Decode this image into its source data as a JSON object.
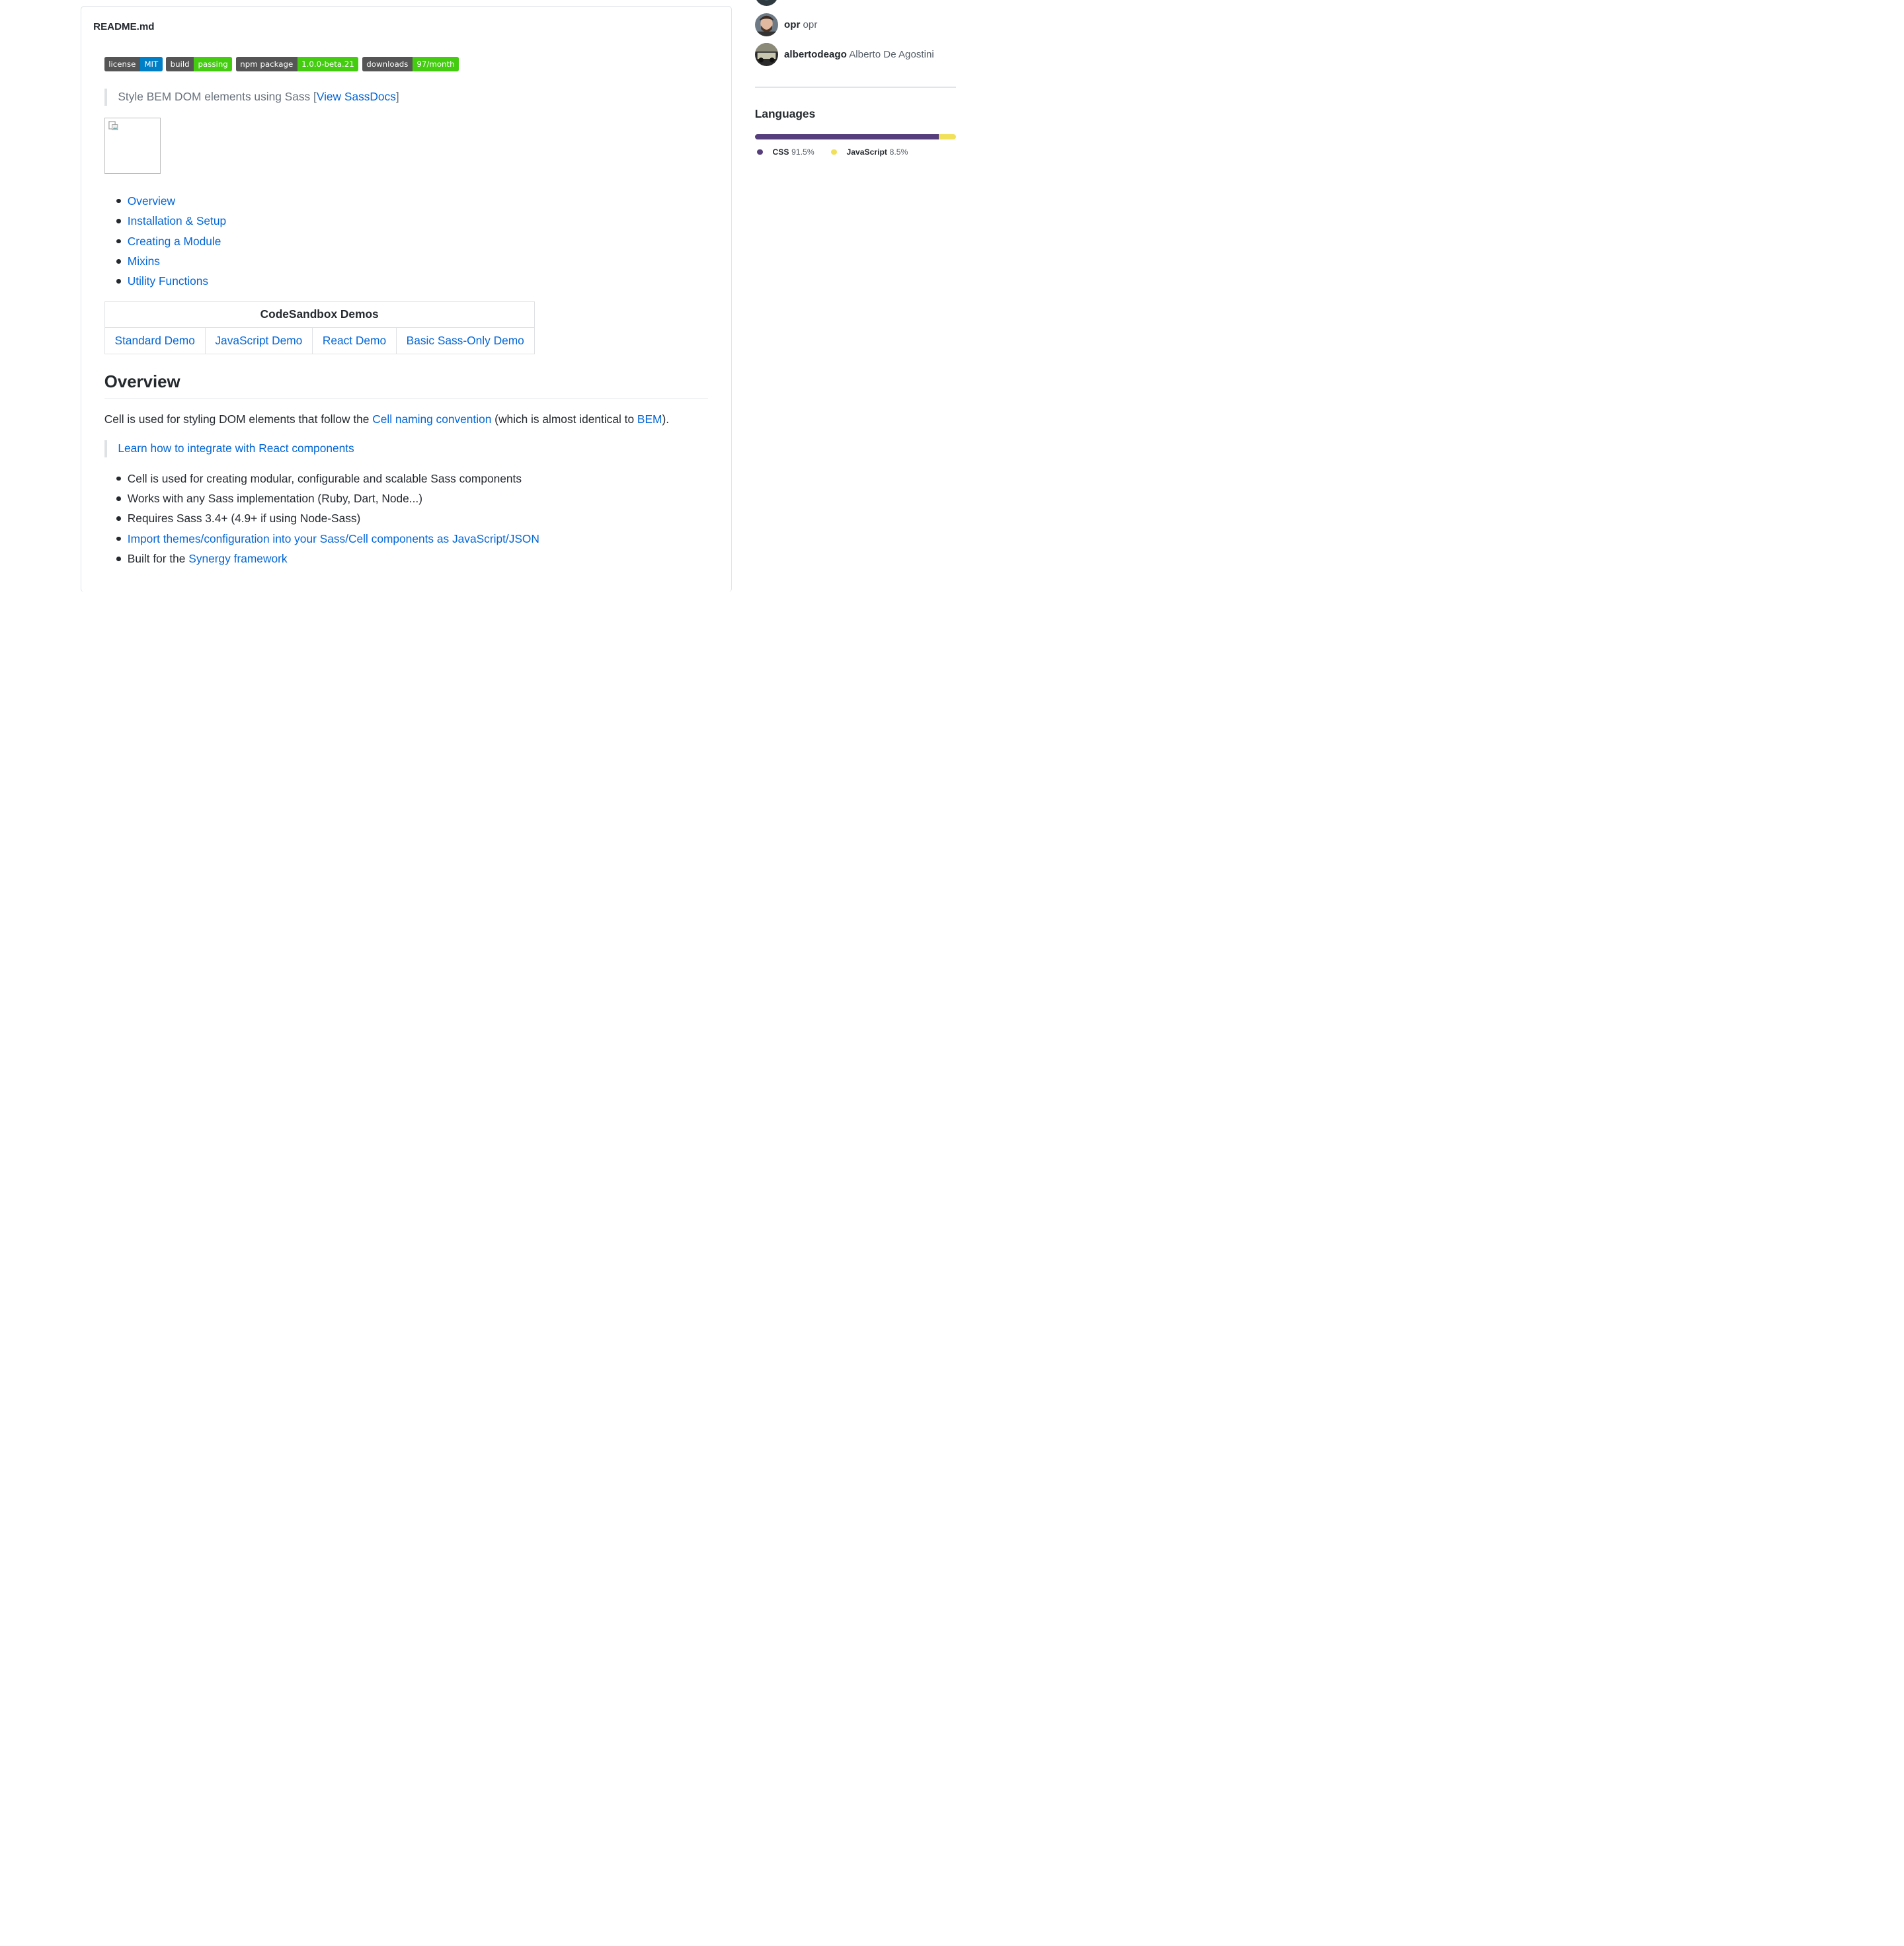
{
  "readme": {
    "title": "README.md"
  },
  "badges": [
    {
      "key": "license",
      "value": "MIT",
      "color": "#007ec6"
    },
    {
      "key": "build",
      "value": "passing",
      "color": "#4c1"
    },
    {
      "key": "npm package",
      "value": "1.0.0-beta.21",
      "color": "#4c1"
    },
    {
      "key": "downloads",
      "value": "97/month",
      "color": "#4c1"
    }
  ],
  "tagline": {
    "text": "Style BEM DOM elements using Sass [",
    "link": "View SassDocs",
    "suffix": "]"
  },
  "toc": [
    "Overview",
    "Installation & Setup",
    "Creating a Module",
    "Mixins",
    "Utility Functions"
  ],
  "demos": {
    "header": "CodeSandbox Demos",
    "links": [
      "Standard Demo",
      "JavaScript Demo",
      "React Demo",
      "Basic Sass-Only Demo"
    ]
  },
  "overview": {
    "heading": "Overview",
    "p1": "Cell is used for styling DOM elements that follow the ",
    "p1_link1": "Cell naming convention",
    "p1_mid": " (which is almost identical to ",
    "p1_link2": "BEM",
    "p1_end": ").",
    "quote_link": "Learn how to integrate with React components"
  },
  "features": {
    "f1": "Cell is used for creating modular, configurable and scalable Sass components",
    "f2": "Works with any Sass implementation (Ruby, Dart, Node...)",
    "f3": "Requires Sass 3.4+ (4.9+ if using Node-Sass)",
    "f4_link": "Import themes/configuration into your Sass/Cell components as JavaScript/JSON",
    "f5_pre": "Built for the ",
    "f5_link": "Synergy framework"
  },
  "contributors": [
    {
      "login": "opr",
      "name": "opr"
    },
    {
      "login": "albertodeago",
      "name": "Alberto De Agostini"
    }
  ],
  "languages": {
    "heading": "Languages",
    "items": [
      {
        "name": "CSS",
        "percent": "91.5%",
        "value": 91.5,
        "color": "#563d7c"
      },
      {
        "name": "JavaScript",
        "percent": "8.5%",
        "value": 8.5,
        "color": "#f1e05a"
      }
    ]
  }
}
